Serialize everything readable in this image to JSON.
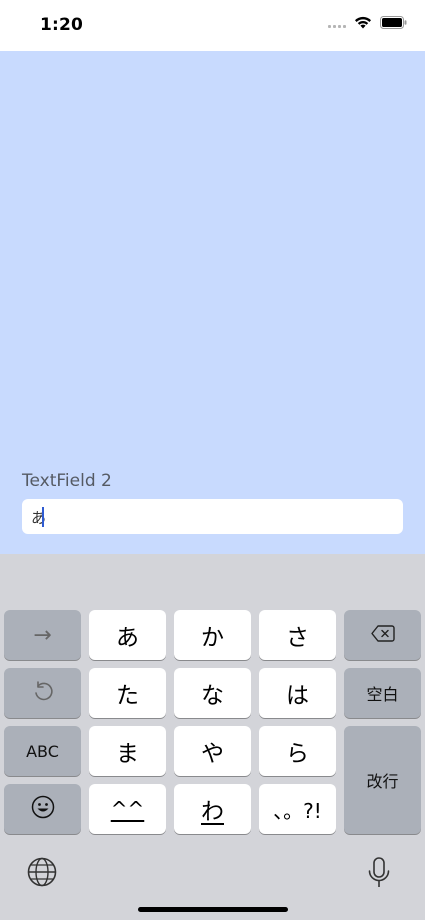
{
  "status": {
    "time": "1:20"
  },
  "form": {
    "label": "TextField 2",
    "value": "あ"
  },
  "keyboard": {
    "row1": {
      "arrow": "→",
      "k1": "あ",
      "k2": "か",
      "k3": "さ",
      "delete_icon": "delete-left-icon"
    },
    "row2": {
      "undo_icon": "undo-icon",
      "k1": "た",
      "k2": "な",
      "k3": "は",
      "space": "空白"
    },
    "row3": {
      "abc": "ABC",
      "k1": "ま",
      "k2": "や",
      "k3": "ら",
      "return": "改行"
    },
    "row4": {
      "emoji_icon": "emoji-icon",
      "k1": "^^",
      "k2": "わ",
      "k3": "、。?!"
    },
    "bottom": {
      "globe_icon": "globe-icon",
      "mic_icon": "microphone-icon"
    }
  },
  "colors": {
    "content_bg": "#c8dafe",
    "keyboard_bg": "#d3d4d9",
    "dark_key": "#abb0b9",
    "caret": "#2f5bd1"
  }
}
